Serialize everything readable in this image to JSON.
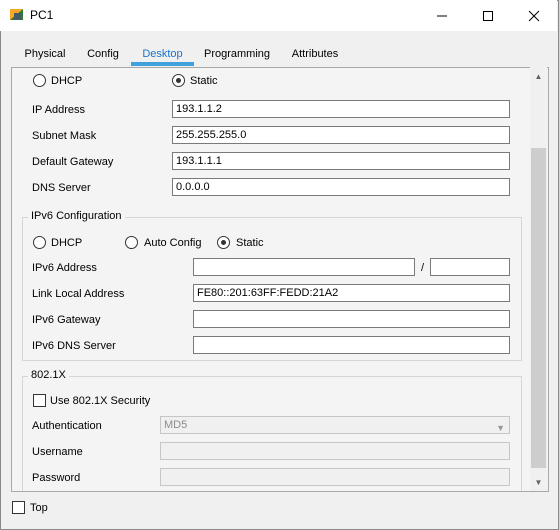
{
  "window": {
    "title": "PC1"
  },
  "tabs": [
    {
      "label": "Physical"
    },
    {
      "label": "Config"
    },
    {
      "label": "Desktop"
    },
    {
      "label": "Programming"
    },
    {
      "label": "Attributes"
    }
  ],
  "ipv4": {
    "dhcp_label": "DHCP",
    "static_label": "Static",
    "ip_address_label": "IP Address",
    "ip_address": "193.1.1.2",
    "subnet_mask_label": "Subnet Mask",
    "subnet_mask": "255.255.255.0",
    "default_gateway_label": "Default Gateway",
    "default_gateway": "193.1.1.1",
    "dns_server_label": "DNS Server",
    "dns_server": "0.0.0.0"
  },
  "ipv6": {
    "title": "IPv6 Configuration",
    "dhcp_label": "DHCP",
    "auto_config_label": "Auto Config",
    "static_label": "Static",
    "address_label": "IPv6 Address",
    "address": "",
    "prefix_separator": "/",
    "prefix": "",
    "link_local_label": "Link Local Address",
    "link_local": "FE80::201:63FF:FEDD:21A2",
    "gateway_label": "IPv6 Gateway",
    "gateway": "",
    "dns_label": "IPv6 DNS Server",
    "dns": ""
  },
  "dot1x": {
    "title": "802.1X",
    "use_security_label": "Use 802.1X Security",
    "authentication_label": "Authentication",
    "authentication_value": "MD5",
    "username_label": "Username",
    "username": "",
    "password_label": "Password",
    "password": ""
  },
  "footer": {
    "top_label": "Top"
  }
}
